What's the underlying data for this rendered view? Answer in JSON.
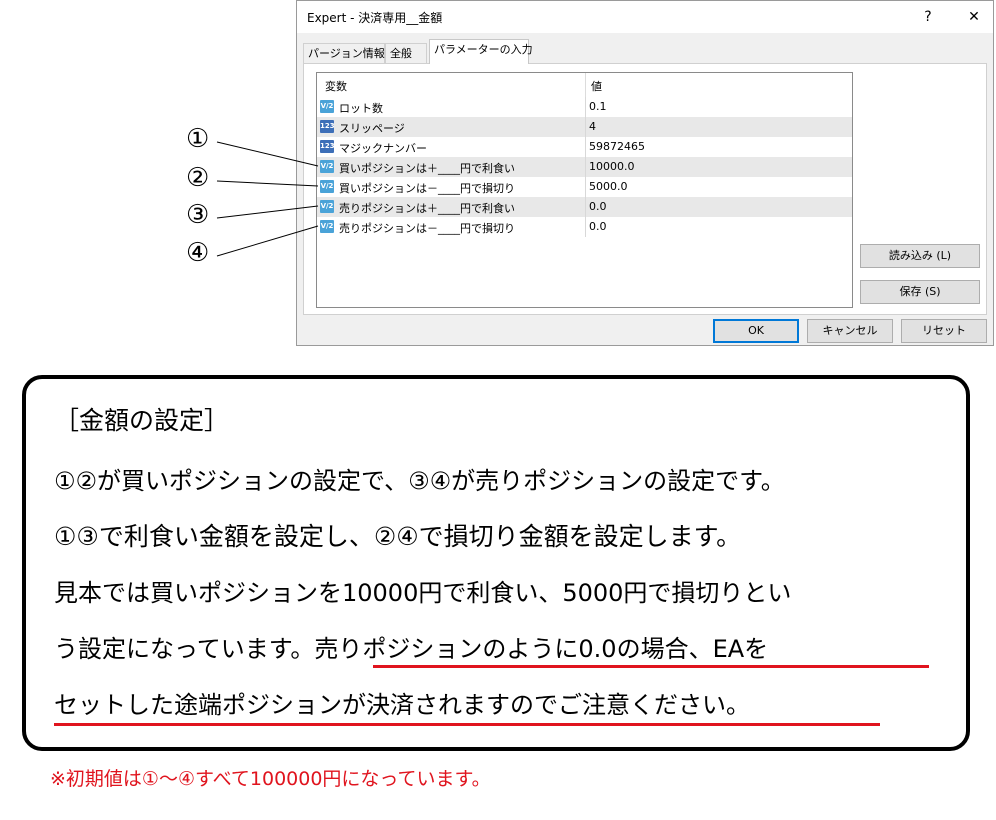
{
  "dialog": {
    "title": "Expert - 決済専用__金額",
    "help_label": "?",
    "close_label": "✕",
    "tabs": [
      "パージョン情報",
      "全般",
      "パラメーターの入力"
    ],
    "active_tab": "パラメーターの入力",
    "table": {
      "headers": {
        "name": "変数",
        "value": "値"
      },
      "rows": [
        {
          "icon": "V/2",
          "name": "ロット数",
          "value": "0.1"
        },
        {
          "icon": "123",
          "name": "スリッページ",
          "value": "4"
        },
        {
          "icon": "123",
          "name": "マジックナンバー",
          "value": "59872465"
        },
        {
          "icon": "V/2",
          "name": "買いポジションは＋____円で利食い",
          "value": "10000.0"
        },
        {
          "icon": "V/2",
          "name": "買いポジションは－____円で損切り",
          "value": "5000.0"
        },
        {
          "icon": "V/2",
          "name": "売りポジションは＋____円で利食い",
          "value": "0.0"
        },
        {
          "icon": "V/2",
          "name": "売りポジションは－____円で損切り",
          "value": "0.0"
        }
      ]
    },
    "buttons": {
      "load": "読み込み (L)",
      "save": "保存 (S)",
      "ok": "OK",
      "cancel": "キャンセル",
      "reset": "リセット"
    }
  },
  "markers": [
    "①",
    "②",
    "③",
    "④"
  ],
  "callout": {
    "heading": "［金額の設定］",
    "line1": "①②が買いポジションの設定で、③④が売りポジションの設定です。",
    "line2": "①③で利食い金額を設定し、②④で損切り金額を設定します。",
    "line3": "見本では買いポジションを10000円で利食い、5000円で損切りとい",
    "line4_plain": "う設定になっています。",
    "line4_emph": "売りポジションのように0.0の場合、EAを",
    "line5_emph": "セットした途端ポジションが決済されますのでご注意ください。"
  },
  "note": "※初期値は①～④すべて100000円になっています。",
  "colors": {
    "accent_red": "#e0141e",
    "default_button_border": "#0078d7"
  }
}
